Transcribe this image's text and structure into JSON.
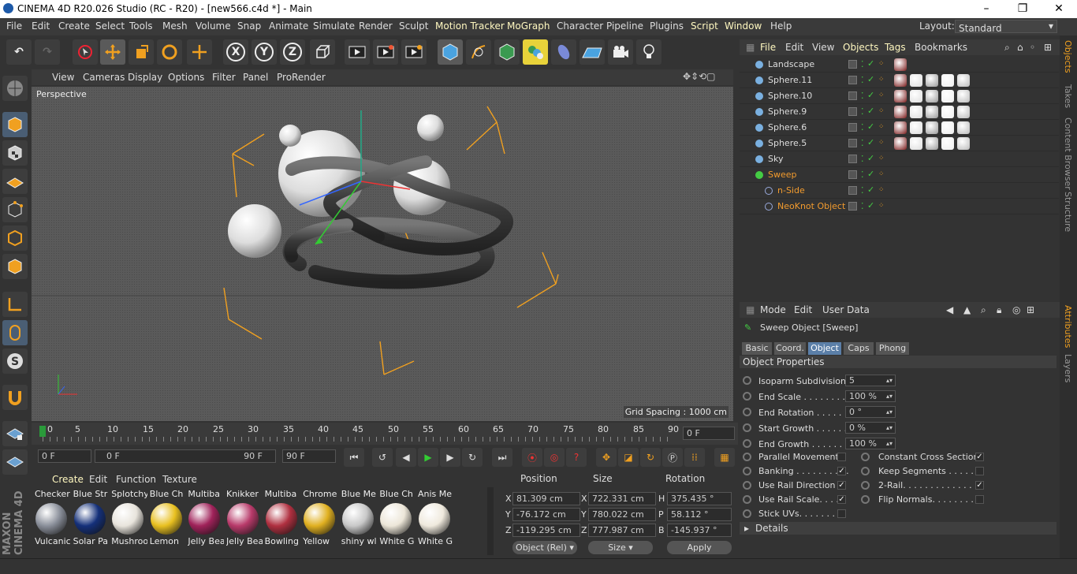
{
  "window": {
    "title": "CINEMA 4D R20.026 Studio (RC - R20) - [new566.c4d *] - Main",
    "controls": [
      "–",
      "❐",
      "✕"
    ]
  },
  "menubar": {
    "items": [
      "File",
      "Edit",
      "Create",
      "Select",
      "Tools",
      "Mesh",
      "Volume",
      "Snap",
      "Animate",
      "Simulate",
      "Render",
      "Sculpt",
      "Motion Tracker",
      "MoGraph",
      "Character",
      "Pipeline",
      "Plugins",
      "Script",
      "Window",
      "Help"
    ],
    "layout_label": "Layout:",
    "layout_value": "Standard"
  },
  "toolbar": {
    "axis_x": "X",
    "axis_y": "Y",
    "axis_z": "Z"
  },
  "viewport": {
    "menu": [
      "View",
      "Cameras",
      "Display",
      "Options",
      "Filter",
      "Panel",
      "ProRender"
    ],
    "label": "Perspective",
    "grid_spacing": "Grid Spacing : 1000 cm"
  },
  "timeline": {
    "ticks": [
      "0",
      "5",
      "10",
      "15",
      "20",
      "25",
      "30",
      "35",
      "40",
      "45",
      "50",
      "55",
      "60",
      "65",
      "70",
      "75",
      "80",
      "85",
      "90"
    ],
    "current_frame": "0 F"
  },
  "playback": {
    "start": "0 F",
    "range_start": "0 F",
    "range_end": "90 F",
    "end": "90 F"
  },
  "materials": {
    "tabs": [
      "Create",
      "Edit",
      "Function",
      "Texture"
    ],
    "items": [
      {
        "top": "Checker",
        "bottom": "Vulcanic",
        "color": "#8a8f9a"
      },
      {
        "top": "Blue Str",
        "bottom": "Solar Pa",
        "color": "#14307a"
      },
      {
        "top": "Splotchy",
        "bottom": "Mushroo",
        "color": "#e8e4dc"
      },
      {
        "top": "Blue Ch",
        "bottom": "Lemon",
        "color": "#e8c020"
      },
      {
        "top": "Multiba",
        "bottom": "Jelly Bea",
        "color": "#a0225a"
      },
      {
        "top": "Knikker",
        "bottom": "Jelly Bea",
        "color": "#b83a6a"
      },
      {
        "top": "Multiba",
        "bottom": "Bowling",
        "color": "#b03040"
      },
      {
        "top": "Chrome",
        "bottom": "Yellow",
        "color": "#e0b020"
      },
      {
        "top": "Blue Me",
        "bottom": "shiny wl",
        "color": "#c8c8c8"
      },
      {
        "top": "Blue Ch",
        "bottom": "White G",
        "color": "#ece6d8"
      },
      {
        "top": "Anis Me",
        "bottom": "White G",
        "color": "#efe9dd"
      }
    ]
  },
  "coordinates": {
    "headers": [
      "Position",
      "Size",
      "Rotation"
    ],
    "rows": [
      {
        "axis": "X",
        "pos": "81.309 cm",
        "size_axis": "X",
        "size": "722.331 cm",
        "rot_axis": "H",
        "rot": "375.435 °"
      },
      {
        "axis": "Y",
        "pos": "-76.172 cm",
        "size_axis": "Y",
        "size": "780.022 cm",
        "rot_axis": "P",
        "rot": "58.112 °"
      },
      {
        "axis": "Z",
        "pos": "-119.295 cm",
        "size_axis": "Z",
        "size": "777.987 cm",
        "rot_axis": "B",
        "rot": "-145.937 °"
      }
    ],
    "mode": "Object (Rel)",
    "size_mode": "Size",
    "apply": "Apply"
  },
  "objects_panel": {
    "menu": [
      "File",
      "Edit",
      "View",
      "Objects",
      "Tags",
      "Bookmarks"
    ],
    "rows": [
      {
        "name": "Landscape",
        "indent": 0,
        "orange": false,
        "tags": 1
      },
      {
        "name": "Sphere.11",
        "indent": 0,
        "orange": false,
        "tags": 5
      },
      {
        "name": "Sphere.10",
        "indent": 0,
        "orange": false,
        "tags": 5
      },
      {
        "name": "Sphere.9",
        "indent": 0,
        "orange": false,
        "tags": 5
      },
      {
        "name": "Sphere.6",
        "indent": 0,
        "orange": false,
        "tags": 5
      },
      {
        "name": "Sphere.5",
        "indent": 0,
        "orange": false,
        "tags": 5
      },
      {
        "name": "Sky",
        "indent": 0,
        "orange": false,
        "tags": 0
      },
      {
        "name": "Sweep",
        "indent": 0,
        "orange": true,
        "tags": 0
      },
      {
        "name": "n-Side",
        "indent": 1,
        "orange": true,
        "tags": 0
      },
      {
        "name": "NeoKnot Object",
        "indent": 1,
        "orange": true,
        "tags": 0
      }
    ]
  },
  "side_tabs": [
    "Objects",
    "Takes",
    "Content Browser",
    "Structure",
    "Attributes",
    "Layers"
  ],
  "attributes": {
    "menu": [
      "Mode",
      "Edit",
      "User Data"
    ],
    "object_title": "Sweep Object [Sweep]",
    "tabs": [
      "Basic",
      "Coord.",
      "Object",
      "Caps",
      "Phong"
    ],
    "selected_tab": "Object",
    "section": "Object Properties",
    "fields": [
      {
        "label": "Isoparm Subdivision",
        "value": "5"
      },
      {
        "label": "End Scale . . . . . . . . .",
        "value": "100 %"
      },
      {
        "label": "End Rotation . . . . . .",
        "value": "0 °"
      },
      {
        "label": "Start Growth . . . . . .",
        "value": "0 %"
      },
      {
        "label": "End Growth . . . . . . .",
        "value": "100 %"
      }
    ],
    "checks_left": [
      {
        "label": "Parallel Movement",
        "checked": false
      },
      {
        "label": "Banking . . . . . . . . . .",
        "checked": true
      },
      {
        "label": "Use Rail Direction",
        "checked": true
      },
      {
        "label": "Use Rail Scale. . . . .",
        "checked": true
      },
      {
        "label": "Stick UVs. . . . . . . . .",
        "checked": false
      }
    ],
    "checks_right": [
      {
        "label": "Constant Cross Section",
        "checked": true
      },
      {
        "label": "Keep Segments . . . . . .",
        "checked": false
      },
      {
        "label": "2-Rail. . . . . . . . . . . . . .",
        "checked": true
      },
      {
        "label": "Flip Normals. . . . . . . . .",
        "checked": false
      }
    ],
    "details": "Details"
  }
}
